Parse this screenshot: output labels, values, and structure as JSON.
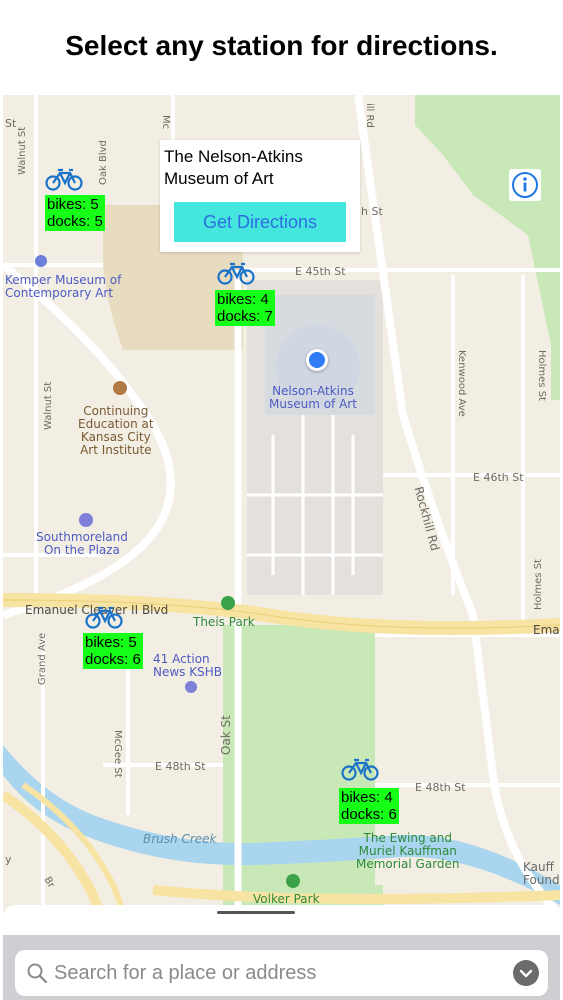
{
  "header": {
    "title": "Select any station for directions."
  },
  "callout": {
    "title": "The Nelson-Atkins Museum of Art",
    "button_label": "Get Directions"
  },
  "stations": [
    {
      "bikes_text": "bikes: 5",
      "docks_text": "docks: 5"
    },
    {
      "bikes_text": "bikes: 4",
      "docks_text": "docks: 7"
    },
    {
      "bikes_text": "bikes: 5",
      "docks_text": "docks: 6"
    },
    {
      "bikes_text": "bikes: 4",
      "docks_text": "docks: 6"
    }
  ],
  "map": {
    "streets": {
      "walnut_st_top": "Walnut St",
      "st_top_left": "St",
      "oak_blvd": "Oak Blvd",
      "mc_top": "Mc",
      "rd_top": "ill Rd",
      "h_st": "h St",
      "e45": "E 45th St",
      "walnut_st_mid": "Walnut St",
      "kenwood": "Kenwood Ave",
      "holmes_top": "Holmes St",
      "e46": "E 46th St",
      "rockhill": "Rockhill Rd",
      "holmes_mid": "Holmes St",
      "emanuel": "Emanuel Cleaver II Blvd",
      "ema": "Ema",
      "grand": "Grand Ave",
      "mcgee": "McGee St",
      "oak_st": "Oak St",
      "e48": "E 48th St",
      "e48_right": "E 48th St",
      "brush_creek": "Brush Creek",
      "y_left": "y",
      "br_left": "Br"
    },
    "pois": {
      "kemper": "Kemper Museum of\nContemporary Art",
      "nelson": "Nelson-Atkins\nMuseum of Art",
      "continuing": "Continuing\nEducation at\nKansas City\nArt Institute",
      "southmoreland": "Southmoreland\nOn the Plaza",
      "theis": "Theis Park",
      "action": "41 Action\nNews KSHB",
      "ewing": "The Ewing and\nMuriel Kauffman\nMemorial Garden",
      "volker": "Volker Park",
      "kauff": "Kauff\nFound"
    }
  },
  "search": {
    "placeholder": "Search for a place or address"
  },
  "icons": {
    "bike": "bicycle-icon",
    "info": "info-icon",
    "user_location": "user-location-dot",
    "search": "search-icon",
    "chevron": "chevron-down-icon"
  },
  "colors": {
    "station_bg": "#16ff16",
    "button_bg": "#44e6de",
    "button_text": "#2d6ee0",
    "park": "#c9e8b8",
    "water": "#a9d6ee",
    "road_major": "#f7e3a2",
    "location": "#2f7cf6"
  }
}
